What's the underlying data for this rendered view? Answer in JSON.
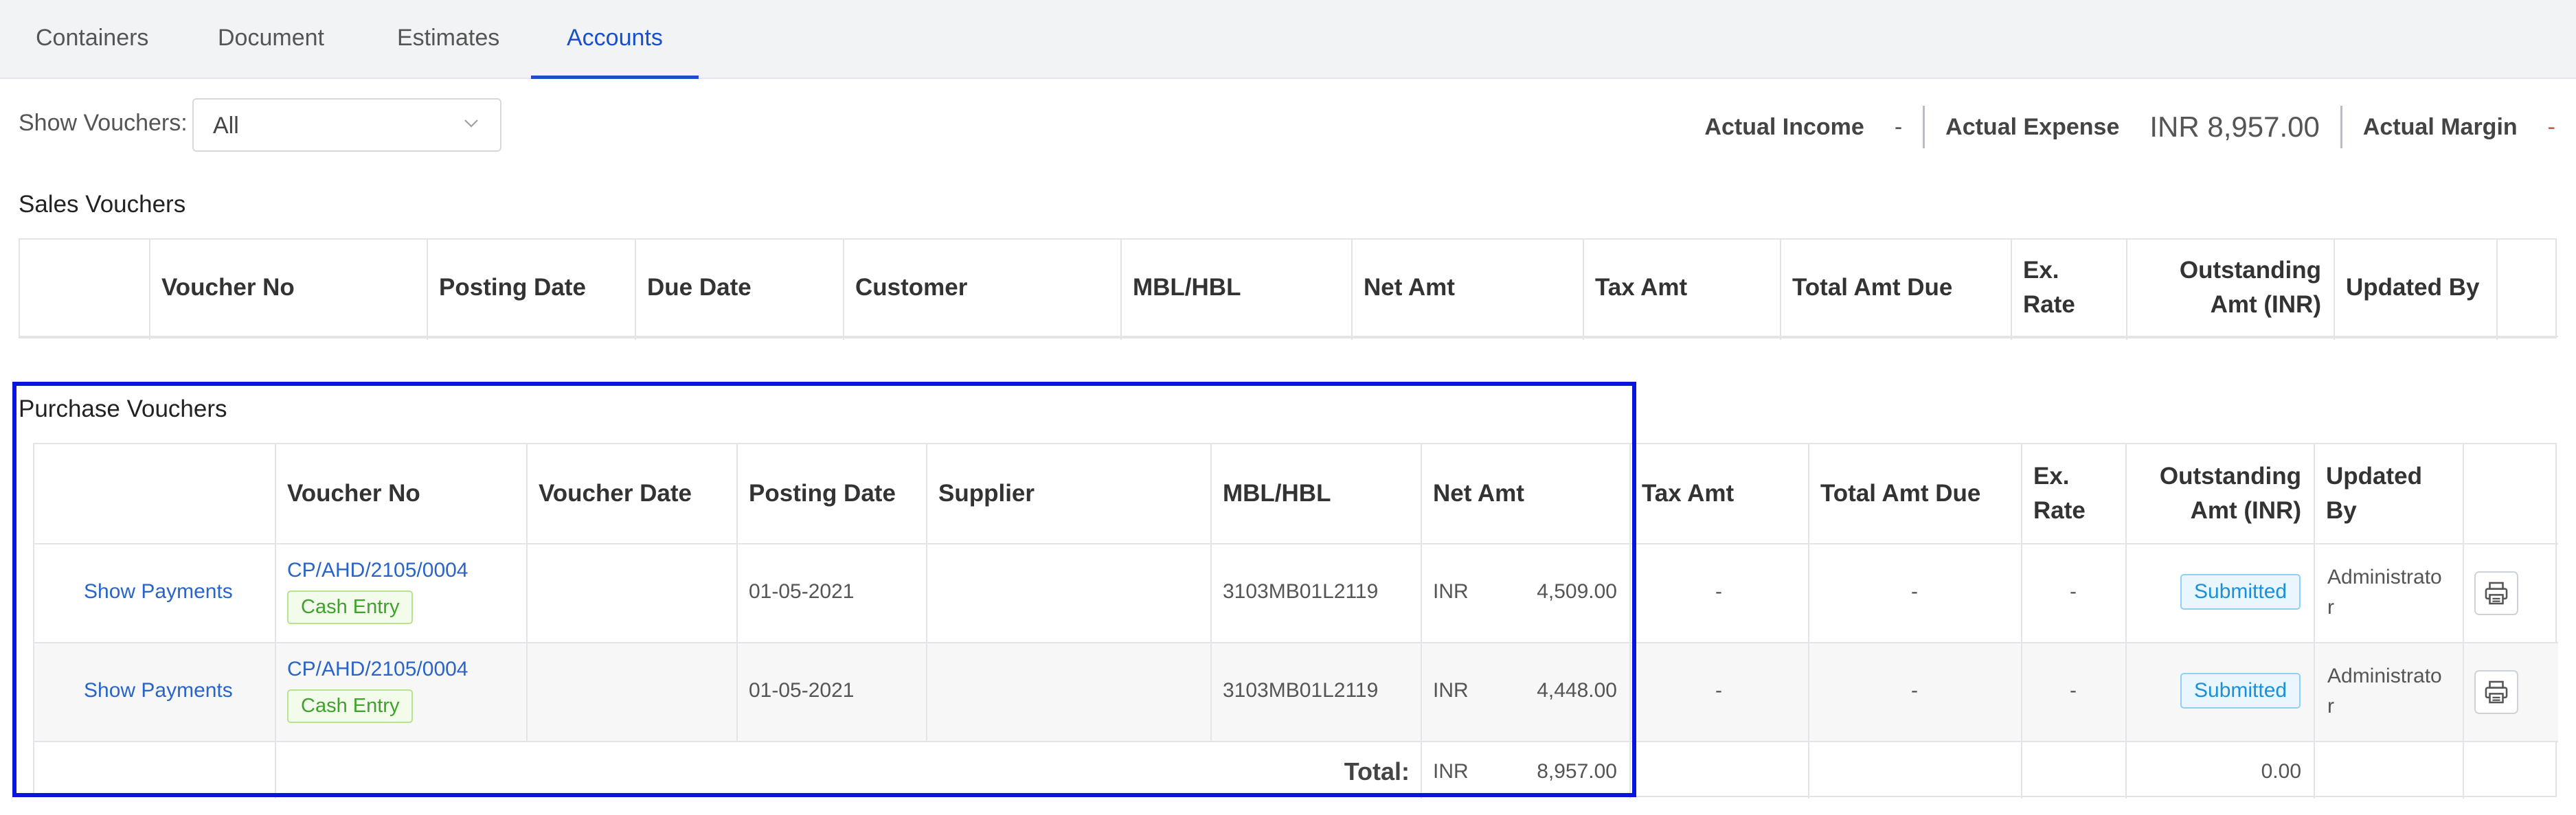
{
  "tabs": [
    "Containers",
    "Document",
    "Estimates",
    "Accounts"
  ],
  "active_tab": "Accounts",
  "filter": {
    "label": "Show Vouchers:",
    "value": "All"
  },
  "summary": {
    "actual_income_label": "Actual Income",
    "actual_income_value": "-",
    "actual_expense_label": "Actual Expense",
    "actual_expense_value": "INR 8,957.00",
    "actual_margin_label": "Actual Margin",
    "actual_margin_value": "-"
  },
  "sales": {
    "title": "Sales Vouchers",
    "headers": [
      "Voucher No",
      "Posting Date",
      "Due Date",
      "Customer",
      "MBL/HBL",
      "Net Amt",
      "Tax Amt",
      "Total Amt Due",
      "Ex.\nRate",
      "Outstanding\nAmt (INR)",
      "Updated By"
    ]
  },
  "purchase": {
    "title": "Purchase Vouchers",
    "headers": [
      "Voucher No",
      "Voucher Date",
      "Posting Date",
      "Supplier",
      "MBL/HBL",
      "Net Amt",
      "Tax Amt",
      "Total Amt Due",
      "Ex.\nRate",
      "Outstanding\nAmt (INR)",
      "Updated\nBy"
    ],
    "rows": [
      {
        "action": "Show Payments",
        "voucher_no": "CP/AHD/2105/0004",
        "tag": "Cash Entry",
        "voucher_date": "",
        "posting_date": "01-05-2021",
        "supplier": "",
        "mbl_hbl": "3103MB01L2119",
        "currency": "INR",
        "net_amt": "4,509.00",
        "tax_amt": "-",
        "total_amt_due": "-",
        "ex_rate": "-",
        "status": "Submitted",
        "updated_by": "Administrato\nr"
      },
      {
        "action": "Show Payments",
        "voucher_no": "CP/AHD/2105/0004",
        "tag": "Cash Entry",
        "voucher_date": "",
        "posting_date": "01-05-2021",
        "supplier": "",
        "mbl_hbl": "3103MB01L2119",
        "currency": "INR",
        "net_amt": "4,448.00",
        "tax_amt": "-",
        "total_amt_due": "-",
        "ex_rate": "-",
        "status": "Submitted",
        "updated_by": "Administrato\nr"
      }
    ],
    "total": {
      "label": "Total:",
      "currency": "INR",
      "net_amt": "8,957.00",
      "outstanding": "0.00"
    }
  },
  "icons": {
    "print": "print-icon",
    "dropdown": "chevron-down-icon"
  },
  "colors": {
    "accent": "#1a4fc9",
    "highlight": "#0a14e0",
    "tag_green": "#3fa12e",
    "tag_blue": "#1c8fd6"
  }
}
